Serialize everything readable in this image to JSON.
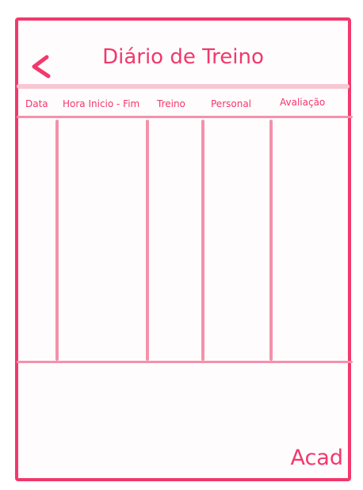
{
  "header": {
    "title": "Diário de Treino",
    "back_icon": "chevron-left-icon"
  },
  "table": {
    "columns": [
      "Data",
      "Hora Inicio - Fim",
      "Treino",
      "Personal",
      "Avaliação"
    ],
    "rows": []
  },
  "footer": {
    "brand": "Acad"
  },
  "colors": {
    "accent": "#f2386c",
    "grid": "#f591ab",
    "title_bar": "#f9c6d3"
  }
}
